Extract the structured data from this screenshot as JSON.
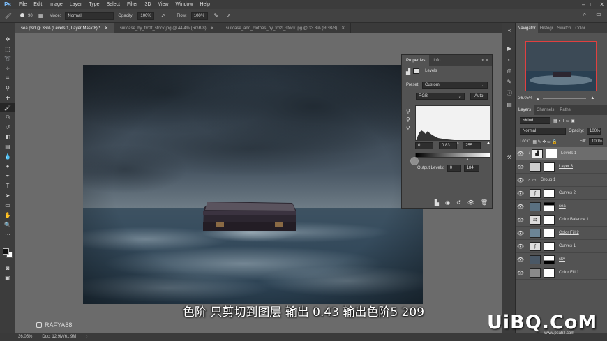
{
  "menu": {
    "logo": "Ps",
    "items": [
      "File",
      "Edit",
      "Image",
      "Layer",
      "Type",
      "Select",
      "Filter",
      "3D",
      "View",
      "Window",
      "Help"
    ]
  },
  "options": {
    "brush_size": "90",
    "mode_label": "Mode:",
    "mode_value": "Normal",
    "opacity_label": "Opacity:",
    "opacity_value": "100%",
    "flow_label": "Flow:",
    "flow_value": "100%"
  },
  "tabs": [
    {
      "label": "sea.psd @ 36% (Levels 1, Layer Mask/8) *",
      "active": true
    },
    {
      "label": "suitcase_by_frozt_stock.jpg @ 44.4% (RGB/8)",
      "active": false
    },
    {
      "label": "suitcase_and_clothes_by_frozt_stock.jpg @ 33.3% (RGB/8)",
      "active": false
    }
  ],
  "properties": {
    "tab_properties": "Properties",
    "tab_info": "Info",
    "adjustment": "Levels",
    "preset_label": "Preset:",
    "preset_value": "Custom",
    "channel": "RGB",
    "auto_label": "Auto",
    "input_black": "0",
    "input_mid": "0.83",
    "input_white": "255",
    "output_label": "Output Levels:",
    "output_black": "0",
    "output_white": "184"
  },
  "navigator": {
    "tabs": [
      "Navigator",
      "Histogr",
      "Swatch",
      "Color"
    ],
    "zoom": "36.05%"
  },
  "layers_panel": {
    "tabs": [
      "Layers",
      "Channels",
      "Paths"
    ],
    "kind_label": "Kind",
    "blend_mode": "Normal",
    "opacity_label": "Opacity:",
    "opacity_value": "100%",
    "lock_label": "Lock:",
    "fill_label": "Fill:",
    "fill_value": "100%",
    "layers": [
      {
        "name": "Levels 1",
        "selected": true
      },
      {
        "name": "Layer 3",
        "selected": false
      },
      {
        "name": "Group 1",
        "selected": false
      },
      {
        "name": "Curves 2",
        "selected": false
      },
      {
        "name": "sea",
        "selected": false
      },
      {
        "name": "Color Balance 1",
        "selected": false
      },
      {
        "name": "Color Fill 2",
        "selected": false
      },
      {
        "name": "Curves 1",
        "selected": false
      },
      {
        "name": "sky",
        "selected": false
      },
      {
        "name": "Color Fill 1",
        "selected": false
      }
    ]
  },
  "status": {
    "zoom": "36.05%",
    "doc": "Doc: 12.9M/61.9M"
  },
  "captions": {
    "subtitle": "色阶  只剪切到图层   输出 0.43   输出色阶5  209",
    "watermark": "RAFYA88",
    "brand": "UiBQ.CoM",
    "brand_sub": "www.psahz.com"
  },
  "colors": {
    "accent_red": "#e04040",
    "panel_bg": "#535353",
    "bar_bg": "#3c3c3c"
  }
}
